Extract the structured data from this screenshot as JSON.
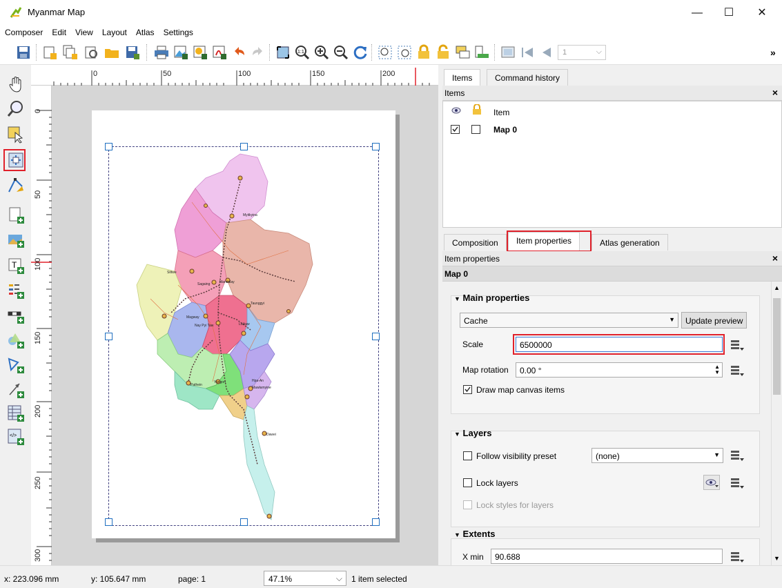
{
  "window": {
    "title": "Myanmar Map",
    "minimize": "—",
    "maximize": "☐",
    "close": "✕"
  },
  "menu": [
    "Composer",
    "Edit",
    "View",
    "Layout",
    "Atlas",
    "Settings"
  ],
  "toolbar": {
    "page_value": "1",
    "more": "»",
    "icons": [
      "save-icon",
      "new-composer-icon",
      "duplicate-composer-icon",
      "composer-manager-icon",
      "open-template-icon",
      "save-template-icon",
      "print-icon",
      "export-image-icon",
      "export-svg-icon",
      "export-pdf-icon",
      "undo-icon",
      "redo-icon",
      "zoom-full-icon",
      "zoom-actual-icon",
      "zoom-in-icon",
      "zoom-out-icon",
      "refresh-icon",
      "group-icon",
      "ungroup-icon",
      "lock-icon",
      "unlock-icon",
      "raise-icon",
      "lower-icon",
      "atlas-preview-icon",
      "first-feature-icon",
      "previous-feature-icon"
    ]
  },
  "left_tools": [
    "pan-icon",
    "zoom-tool-icon",
    "select-move-icon",
    "move-content-icon",
    "edit-nodes-icon",
    "add-map-icon",
    "add-image-icon",
    "add-label-icon",
    "add-legend-icon",
    "add-scalebar-icon",
    "add-shape-icon",
    "add-polygon-icon",
    "add-arrow-icon",
    "add-table-icon",
    "add-html-icon"
  ],
  "ruler_h": [
    "0",
    "50",
    "100",
    "150",
    "200"
  ],
  "ruler_v": [
    "0",
    "50",
    "100",
    "150",
    "200",
    "250",
    "300"
  ],
  "map_labels": [
    "Myitkyina",
    "Sittwe",
    "Sagaing",
    "Mandalay",
    "Taunggyi",
    "Magway",
    "Nay Pyi Taw",
    "Loikaw",
    "Pathein",
    "Yangon",
    "Hpa-An",
    "Mawlamyine",
    "Dawei"
  ],
  "panel": {
    "tabs_top": [
      "Items",
      "Command history"
    ],
    "items_title": "Items",
    "items_header": "Item",
    "items": [
      {
        "name": "Map 0",
        "visible": true,
        "locked": false
      }
    ],
    "tabs_bottom": [
      "Composition",
      "Item properties",
      "Atlas generation"
    ],
    "props_title": "Item properties",
    "item_name": "Map 0",
    "main": {
      "title": "Main properties",
      "cache": "Cache",
      "update_preview": "Update preview",
      "scale_label": "Scale",
      "scale": "6500000",
      "rotation_label": "Map rotation",
      "rotation": "0.00 °",
      "draw_canvas": "Draw map canvas items"
    },
    "layers": {
      "title": "Layers",
      "follow_preset": "Follow visibility preset",
      "preset": "(none)",
      "lock_layers": "Lock layers",
      "lock_styles": "Lock styles for layers"
    },
    "extents": {
      "title": "Extents",
      "xmin_label": "X min",
      "xmin": "90.688"
    }
  },
  "status": {
    "x": "x: 223.096 mm",
    "y": "y: 105.647 mm",
    "page": "page: 1",
    "zoom": "47.1%",
    "selected": "1 item selected"
  }
}
